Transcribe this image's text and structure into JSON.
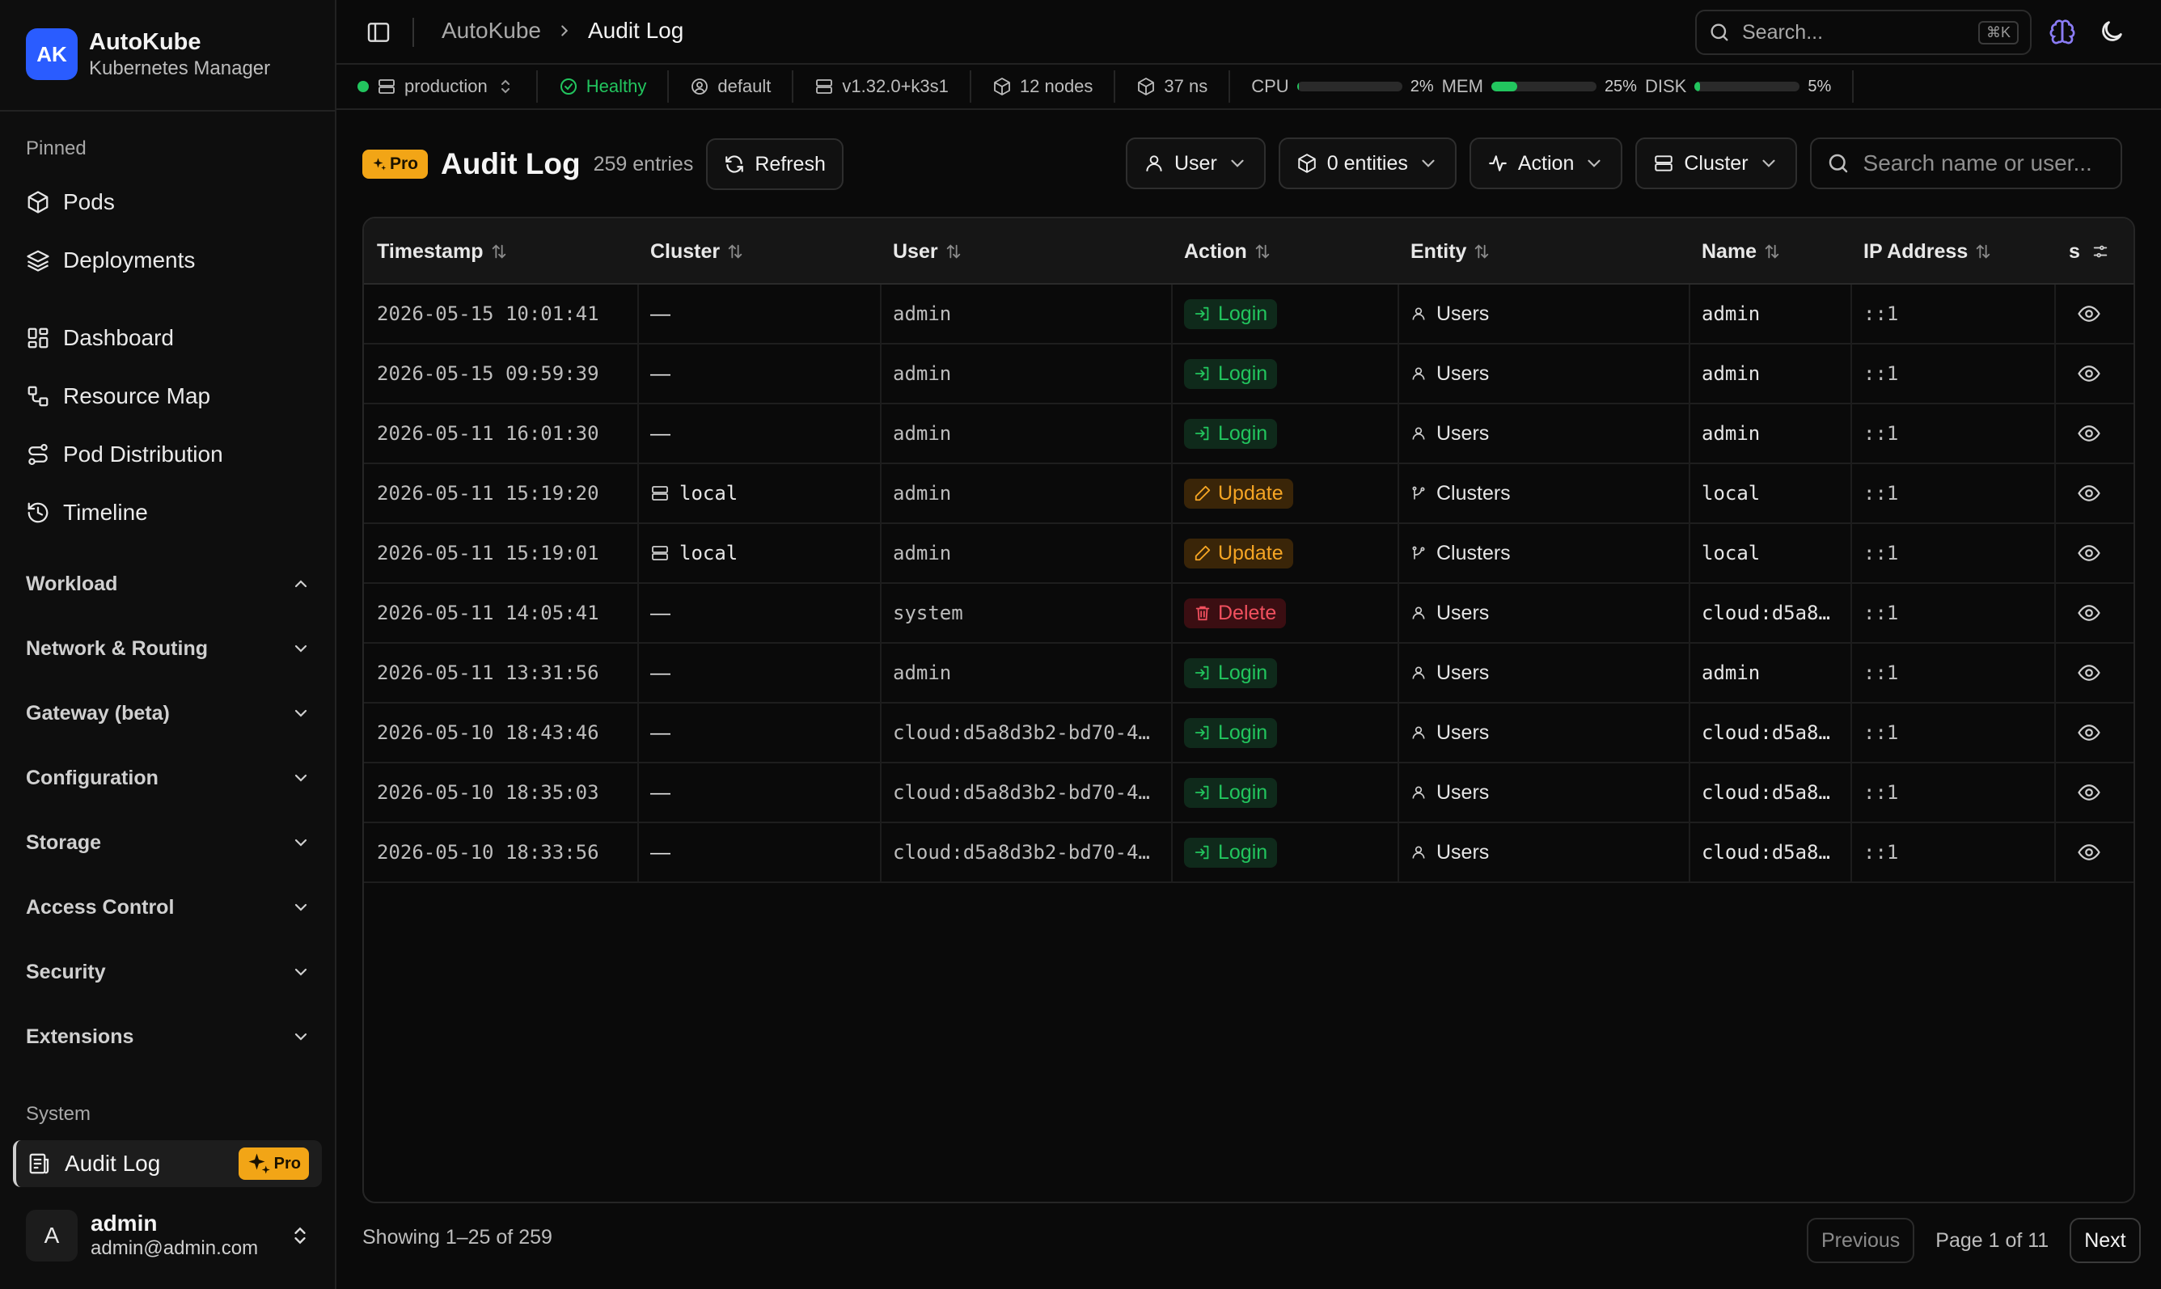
{
  "app": {
    "logo": "AK",
    "name": "AutoKube",
    "subtitle": "Kubernetes Manager"
  },
  "sidebar": {
    "pinned_label": "Pinned",
    "pinned": [
      {
        "label": "Pods",
        "icon": "box-icon"
      },
      {
        "label": "Deployments",
        "icon": "layers-icon"
      }
    ],
    "nav": [
      {
        "label": "Dashboard",
        "icon": "dashboard-icon"
      },
      {
        "label": "Resource Map",
        "icon": "resource-map-icon"
      },
      {
        "label": "Pod Distribution",
        "icon": "route-icon"
      },
      {
        "label": "Timeline",
        "icon": "history-icon"
      }
    ],
    "groups": [
      {
        "label": "Workload",
        "expanded": true
      },
      {
        "label": "Network & Routing",
        "expanded": false
      },
      {
        "label": "Gateway (beta)",
        "expanded": false
      },
      {
        "label": "Configuration",
        "expanded": false
      },
      {
        "label": "Storage",
        "expanded": false
      },
      {
        "label": "Access Control",
        "expanded": false
      },
      {
        "label": "Security",
        "expanded": false
      },
      {
        "label": "Extensions",
        "expanded": false
      }
    ],
    "system_label": "System",
    "active_item": {
      "label": "Audit Log",
      "badge": "Pro"
    },
    "user": {
      "initial": "A",
      "name": "admin",
      "email": "admin@admin.com"
    }
  },
  "header": {
    "breadcrumb": [
      "AutoKube",
      "Audit Log"
    ],
    "search_placeholder": "Search...",
    "search_shortcut": "⌘K"
  },
  "status": {
    "cluster": "production",
    "health": "Healthy",
    "namespace": "default",
    "version": "v1.32.0+k3s1",
    "nodes": "12 nodes",
    "namespaces": "37 ns",
    "cpu_label": "CPU",
    "cpu_pct": "2%",
    "cpu_value": 2,
    "mem_label": "MEM",
    "mem_pct": "25%",
    "mem_value": 25,
    "disk_label": "DISK",
    "disk_pct": "5%",
    "disk_value": 5
  },
  "page": {
    "badge": "Pro",
    "title": "Audit Log",
    "count": "259 entries",
    "refresh": "Refresh",
    "filters": {
      "user": "User",
      "entities": "0 entities",
      "action": "Action",
      "cluster": "Cluster"
    },
    "search_placeholder": "Search name or user..."
  },
  "table": {
    "columns": [
      "Timestamp",
      "Cluster",
      "User",
      "Action",
      "Entity",
      "Name",
      "IP Address",
      "s"
    ],
    "rows": [
      {
        "timestamp": "2026-05-15 10:01:41",
        "cluster": "—",
        "user": "admin",
        "action": "Login",
        "entity": "Users",
        "name": "admin",
        "ip": "::1"
      },
      {
        "timestamp": "2026-05-15 09:59:39",
        "cluster": "—",
        "user": "admin",
        "action": "Login",
        "entity": "Users",
        "name": "admin",
        "ip": "::1"
      },
      {
        "timestamp": "2026-05-11 16:01:30",
        "cluster": "—",
        "user": "admin",
        "action": "Login",
        "entity": "Users",
        "name": "admin",
        "ip": "::1"
      },
      {
        "timestamp": "2026-05-11 15:19:20",
        "cluster": "local",
        "user": "admin",
        "action": "Update",
        "entity": "Clusters",
        "name": "local",
        "ip": "::1"
      },
      {
        "timestamp": "2026-05-11 15:19:01",
        "cluster": "local",
        "user": "admin",
        "action": "Update",
        "entity": "Clusters",
        "name": "local",
        "ip": "::1"
      },
      {
        "timestamp": "2026-05-11 14:05:41",
        "cluster": "—",
        "user": "system",
        "action": "Delete",
        "entity": "Users",
        "name": "cloud:d5a8…",
        "ip": "::1"
      },
      {
        "timestamp": "2026-05-11 13:31:56",
        "cluster": "—",
        "user": "admin",
        "action": "Login",
        "entity": "Users",
        "name": "admin",
        "ip": "::1"
      },
      {
        "timestamp": "2026-05-10 18:43:46",
        "cluster": "—",
        "user": "cloud:d5a8d3b2-bd70-4…",
        "action": "Login",
        "entity": "Users",
        "name": "cloud:d5a8…",
        "ip": "::1"
      },
      {
        "timestamp": "2026-05-10 18:35:03",
        "cluster": "—",
        "user": "cloud:d5a8d3b2-bd70-4…",
        "action": "Login",
        "entity": "Users",
        "name": "cloud:d5a8…",
        "ip": "::1"
      },
      {
        "timestamp": "2026-05-10 18:33:56",
        "cluster": "—",
        "user": "cloud:d5a8d3b2-bd70-4…",
        "action": "Login",
        "entity": "Users",
        "name": "cloud:d5a8…",
        "ip": "::1"
      }
    ]
  },
  "footer": {
    "showing": "Showing 1–25 of 259",
    "previous": "Previous",
    "page_info": "Page 1 of 11",
    "next": "Next"
  },
  "colors": {
    "accent": "#2a5cff",
    "pro": "#f2a516",
    "login": "#22c55e",
    "update": "#f5a524",
    "delete": "#f0505e"
  }
}
